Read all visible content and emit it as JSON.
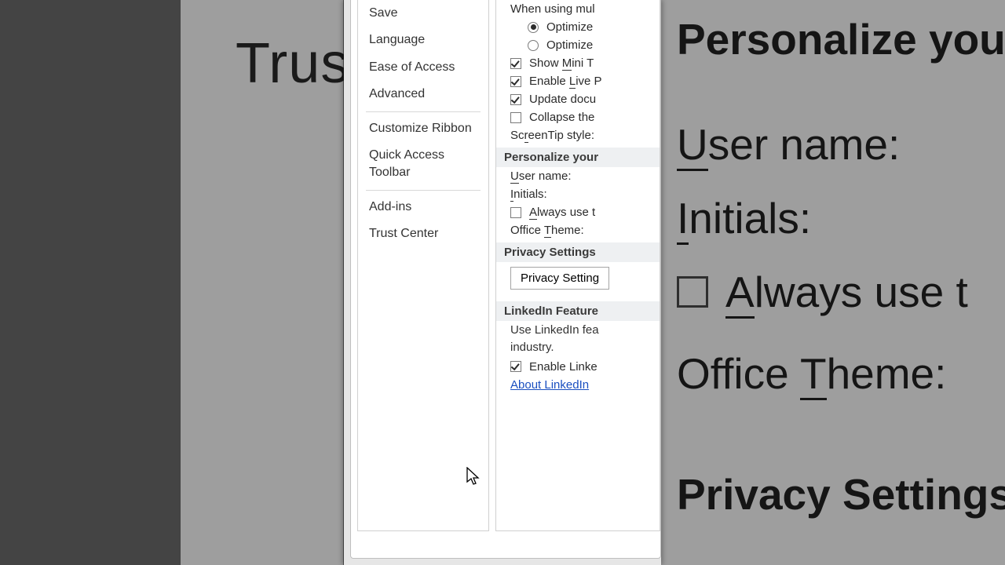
{
  "bg_left": {
    "text": "Trust C"
  },
  "bg_right": {
    "title": "Personalize your",
    "user_name": "User name:",
    "initials": "Initials:",
    "always_use": "Always use t",
    "office_theme": "Office Theme:",
    "privacy": "Privacy Settings"
  },
  "sidebar": {
    "items": [
      {
        "label": "Save"
      },
      {
        "label": "Language"
      },
      {
        "label": "Ease of Access"
      },
      {
        "label": "Advanced"
      }
    ],
    "items2": [
      {
        "label": "Customize Ribbon"
      },
      {
        "label": "Quick Access Toolbar"
      }
    ],
    "items3": [
      {
        "label": "Add-ins"
      },
      {
        "label": "Trust Center"
      }
    ]
  },
  "content": {
    "multi_label": "When using mul",
    "radio_opt1": "Optimize",
    "radio_opt2": "Optimize",
    "chk_show_mini": "Show Mini T",
    "chk_live_preview": "Enable Live P",
    "chk_update_doc": "Update docu",
    "chk_collapse": "Collapse the",
    "screentip": "ScreenTip style:",
    "personalize_head": "Personalize your",
    "user_name": "User name:",
    "initials": "Initials:",
    "chk_always": "Always use t",
    "office_theme": "Office Theme:",
    "privacy_head": "Privacy Settings",
    "privacy_btn": "Privacy Setting",
    "linkedin_head": "LinkedIn Feature",
    "linkedin_desc": "Use LinkedIn fea industry.",
    "linkedin_desc1": "Use LinkedIn fea",
    "linkedin_desc2": "industry.",
    "chk_linkedin": "Enable Linke",
    "linkedin_link": "About LinkedIn"
  }
}
